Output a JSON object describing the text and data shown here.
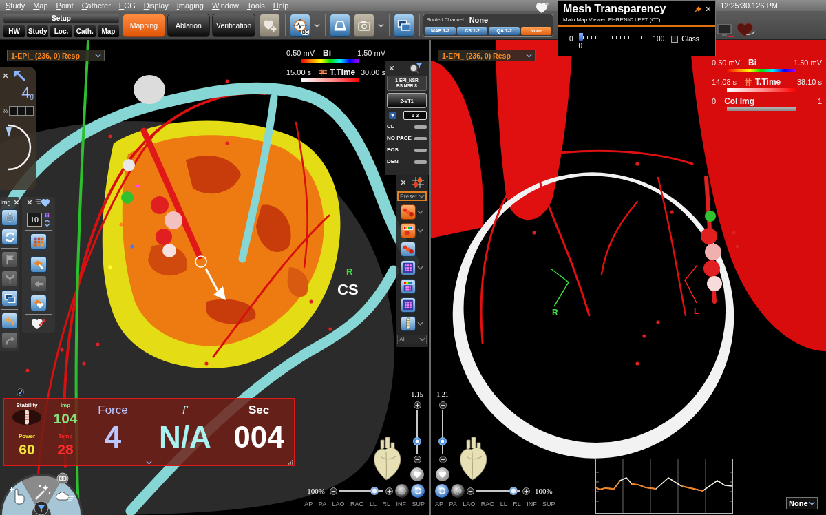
{
  "menu_bar": {
    "items": [
      "Study",
      "Map",
      "Point",
      "Catheter",
      "ECG",
      "Display",
      "Imaging",
      "Window",
      "Tools",
      "Help"
    ],
    "clock": "12:25:30.126 PM"
  },
  "toolbar": {
    "setup": {
      "title": "Setup",
      "tabs": [
        {
          "label": "HW",
          "selected": false
        },
        {
          "label": "Study",
          "selected": false
        },
        {
          "label": "Loc.",
          "selected": false
        },
        {
          "label": "Cath.",
          "selected": false
        },
        {
          "label": "Map",
          "selected": false
        }
      ]
    },
    "modes": [
      {
        "label": "Mapping",
        "selected": true
      },
      {
        "label": "Ablation",
        "selected": false
      },
      {
        "label": "Verification",
        "selected": false
      }
    ],
    "tool_groups": [
      [
        {
          "kind": "heart_plus",
          "disabled": true,
          "dropdown": false
        }
      ],
      [
        {
          "kind": "compass",
          "badge": "BS",
          "disabled": false,
          "dropdown": true
        }
      ],
      [
        {
          "kind": "arch",
          "disabled": false,
          "dropdown": false
        },
        {
          "kind": "camera",
          "disabled": true,
          "dropdown": true
        }
      ],
      [
        {
          "kind": "windows",
          "disabled": false,
          "dropdown": false
        }
      ]
    ]
  },
  "routed_channel": {
    "label": "Routed Channel:",
    "value": "None",
    "channels": [
      {
        "label": "MAP 1-2",
        "selected": false
      },
      {
        "label": "CS 1-2",
        "selected": false
      },
      {
        "label": "QA 1-2",
        "selected": false
      },
      {
        "label": "None",
        "selected": true
      }
    ]
  },
  "mesh_transparency": {
    "title": "Mesh Transparency",
    "subtitle": "Main Map Viewer, PHRENIC LEFT (CT)",
    "min_label": "0",
    "value": "0",
    "max_label": "100",
    "level": 0,
    "glass": {
      "label": "Glass",
      "checked": false
    }
  },
  "viewers": [
    {
      "map_selector": "1-EPI_ (236, 0) Resp",
      "legends": [
        {
          "kind": "rainbow",
          "min": "0.50 mV",
          "name": "Bi",
          "max": "1.50 mV"
        },
        {
          "kind": "time",
          "min": "15.00 s",
          "name": "T.Time",
          "max": "30.00 s"
        }
      ],
      "catheter_panel": {
        "value": "4",
        "unit": "g",
        "percent": "%"
      },
      "image_tools": {
        "title": "Img",
        "button_groups": [
          [
            {
              "kind": "move",
              "disabled": false
            },
            {
              "kind": "rotate",
              "disabled": false
            }
          ],
          [
            {
              "kind": "flag",
              "disabled": true
            },
            {
              "kind": "branch",
              "disabled": true
            },
            {
              "kind": "windows",
              "disabled": false
            }
          ],
          [
            {
              "kind": "undo",
              "disabled": false
            },
            {
              "kind": "redo",
              "disabled": true
            }
          ]
        ]
      },
      "point_tools": {
        "count": "10",
        "button_groups": [
          [
            {
              "kind": "grid",
              "disabled": false
            }
          ],
          [
            {
              "kind": "tag",
              "disabled": false
            },
            {
              "kind": "pointer",
              "disabled": true
            },
            {
              "kind": "heart_tag",
              "disabled": false
            }
          ]
        ]
      },
      "filter_panel": {
        "map": "1-EPI_NSR",
        "detail": "BS NSR 8",
        "reference": "2-VT1",
        "range": "1-2",
        "criteria": [
          "CL",
          "NO PACE",
          "POS",
          "DEN"
        ]
      },
      "display_tools": {
        "preset": "Preset",
        "buttons": [
          {
            "kind": "balls",
            "active": true,
            "dropdown": true
          },
          {
            "kind": "color_bar",
            "active": true,
            "dropdown": true
          },
          {
            "kind": "balls",
            "active": false,
            "dropdown": false
          },
          {
            "kind": "dot_grid",
            "active": false,
            "dropdown": true
          },
          {
            "kind": "color_grid",
            "active": false,
            "dropdown": false
          },
          {
            "kind": "dot_grid",
            "active": false,
            "dropdown": false
          },
          {
            "kind": "catheter",
            "active": false,
            "dropdown": true
          }
        ],
        "filter": "All"
      },
      "labels": [
        {
          "text": "R",
          "color": "#3ee03e"
        },
        {
          "text": "CS",
          "color": "#ffffff"
        }
      ],
      "ablation_panel": {
        "stability": "Stability",
        "metrics": [
          {
            "label": "Imp",
            "value": "104",
            "color": "#86e07c"
          },
          {
            "label": "Power",
            "value": "60",
            "color": "#f4e83c"
          },
          {
            "label": "Temp",
            "value": "28",
            "color": "#ff2a2a"
          }
        ],
        "readouts": [
          {
            "label": "Force",
            "value": "4",
            "color": "#bcc6ff",
            "italic": false,
            "bold": false
          },
          {
            "label": "f'",
            "value": "N/A",
            "color": "#a8f2f2",
            "italic": true,
            "bold": false
          },
          {
            "label": "Sec",
            "value": "004",
            "color": "#ffffff",
            "italic": false,
            "bold": true
          }
        ]
      },
      "zoom": {
        "value": "1.15",
        "level": 0.25
      },
      "scale": {
        "value": "100%",
        "level": 0.86
      },
      "views": [
        "AP",
        "PA",
        "LAO",
        "RAO",
        "LL",
        "RL",
        "INF",
        "SUP"
      ]
    },
    {
      "map_selector": "1-EPI_ (236, 0) Resp",
      "legends": [
        {
          "kind": "rainbow",
          "min": "0.50 mV",
          "name": "Bi",
          "max": "1.50 mV"
        },
        {
          "kind": "time",
          "min": "14.08 s",
          "name": "T.Time",
          "max": "38.10 s"
        },
        {
          "kind": "gray",
          "min": "0",
          "name": "Col Img",
          "max": "1"
        }
      ],
      "labels": [
        {
          "text": "R",
          "color": "#3ee03e"
        },
        {
          "text": "L",
          "color": "#ff2020"
        }
      ],
      "zoom": {
        "value": "1.21",
        "level": 0.25
      },
      "scale": {
        "value": "100%",
        "level": 0.93
      },
      "views": [
        "AP",
        "PA",
        "LAO",
        "RAO",
        "LL",
        "RL",
        "INF",
        "SUP"
      ],
      "signal_dropdown": "None"
    }
  ]
}
